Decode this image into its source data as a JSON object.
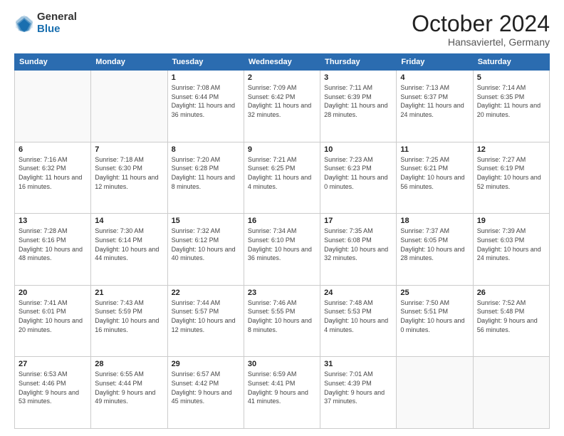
{
  "logo": {
    "general": "General",
    "blue": "Blue"
  },
  "header": {
    "month": "October 2024",
    "location": "Hansaviertel, Germany"
  },
  "days_of_week": [
    "Sunday",
    "Monday",
    "Tuesday",
    "Wednesday",
    "Thursday",
    "Friday",
    "Saturday"
  ],
  "weeks": [
    [
      {
        "day": "",
        "info": ""
      },
      {
        "day": "",
        "info": ""
      },
      {
        "day": "1",
        "info": "Sunrise: 7:08 AM\nSunset: 6:44 PM\nDaylight: 11 hours and 36 minutes."
      },
      {
        "day": "2",
        "info": "Sunrise: 7:09 AM\nSunset: 6:42 PM\nDaylight: 11 hours and 32 minutes."
      },
      {
        "day": "3",
        "info": "Sunrise: 7:11 AM\nSunset: 6:39 PM\nDaylight: 11 hours and 28 minutes."
      },
      {
        "day": "4",
        "info": "Sunrise: 7:13 AM\nSunset: 6:37 PM\nDaylight: 11 hours and 24 minutes."
      },
      {
        "day": "5",
        "info": "Sunrise: 7:14 AM\nSunset: 6:35 PM\nDaylight: 11 hours and 20 minutes."
      }
    ],
    [
      {
        "day": "6",
        "info": "Sunrise: 7:16 AM\nSunset: 6:32 PM\nDaylight: 11 hours and 16 minutes."
      },
      {
        "day": "7",
        "info": "Sunrise: 7:18 AM\nSunset: 6:30 PM\nDaylight: 11 hours and 12 minutes."
      },
      {
        "day": "8",
        "info": "Sunrise: 7:20 AM\nSunset: 6:28 PM\nDaylight: 11 hours and 8 minutes."
      },
      {
        "day": "9",
        "info": "Sunrise: 7:21 AM\nSunset: 6:25 PM\nDaylight: 11 hours and 4 minutes."
      },
      {
        "day": "10",
        "info": "Sunrise: 7:23 AM\nSunset: 6:23 PM\nDaylight: 11 hours and 0 minutes."
      },
      {
        "day": "11",
        "info": "Sunrise: 7:25 AM\nSunset: 6:21 PM\nDaylight: 10 hours and 56 minutes."
      },
      {
        "day": "12",
        "info": "Sunrise: 7:27 AM\nSunset: 6:19 PM\nDaylight: 10 hours and 52 minutes."
      }
    ],
    [
      {
        "day": "13",
        "info": "Sunrise: 7:28 AM\nSunset: 6:16 PM\nDaylight: 10 hours and 48 minutes."
      },
      {
        "day": "14",
        "info": "Sunrise: 7:30 AM\nSunset: 6:14 PM\nDaylight: 10 hours and 44 minutes."
      },
      {
        "day": "15",
        "info": "Sunrise: 7:32 AM\nSunset: 6:12 PM\nDaylight: 10 hours and 40 minutes."
      },
      {
        "day": "16",
        "info": "Sunrise: 7:34 AM\nSunset: 6:10 PM\nDaylight: 10 hours and 36 minutes."
      },
      {
        "day": "17",
        "info": "Sunrise: 7:35 AM\nSunset: 6:08 PM\nDaylight: 10 hours and 32 minutes."
      },
      {
        "day": "18",
        "info": "Sunrise: 7:37 AM\nSunset: 6:05 PM\nDaylight: 10 hours and 28 minutes."
      },
      {
        "day": "19",
        "info": "Sunrise: 7:39 AM\nSunset: 6:03 PM\nDaylight: 10 hours and 24 minutes."
      }
    ],
    [
      {
        "day": "20",
        "info": "Sunrise: 7:41 AM\nSunset: 6:01 PM\nDaylight: 10 hours and 20 minutes."
      },
      {
        "day": "21",
        "info": "Sunrise: 7:43 AM\nSunset: 5:59 PM\nDaylight: 10 hours and 16 minutes."
      },
      {
        "day": "22",
        "info": "Sunrise: 7:44 AM\nSunset: 5:57 PM\nDaylight: 10 hours and 12 minutes."
      },
      {
        "day": "23",
        "info": "Sunrise: 7:46 AM\nSunset: 5:55 PM\nDaylight: 10 hours and 8 minutes."
      },
      {
        "day": "24",
        "info": "Sunrise: 7:48 AM\nSunset: 5:53 PM\nDaylight: 10 hours and 4 minutes."
      },
      {
        "day": "25",
        "info": "Sunrise: 7:50 AM\nSunset: 5:51 PM\nDaylight: 10 hours and 0 minutes."
      },
      {
        "day": "26",
        "info": "Sunrise: 7:52 AM\nSunset: 5:48 PM\nDaylight: 9 hours and 56 minutes."
      }
    ],
    [
      {
        "day": "27",
        "info": "Sunrise: 6:53 AM\nSunset: 4:46 PM\nDaylight: 9 hours and 53 minutes."
      },
      {
        "day": "28",
        "info": "Sunrise: 6:55 AM\nSunset: 4:44 PM\nDaylight: 9 hours and 49 minutes."
      },
      {
        "day": "29",
        "info": "Sunrise: 6:57 AM\nSunset: 4:42 PM\nDaylight: 9 hours and 45 minutes."
      },
      {
        "day": "30",
        "info": "Sunrise: 6:59 AM\nSunset: 4:41 PM\nDaylight: 9 hours and 41 minutes."
      },
      {
        "day": "31",
        "info": "Sunrise: 7:01 AM\nSunset: 4:39 PM\nDaylight: 9 hours and 37 minutes."
      },
      {
        "day": "",
        "info": ""
      },
      {
        "day": "",
        "info": ""
      }
    ]
  ]
}
